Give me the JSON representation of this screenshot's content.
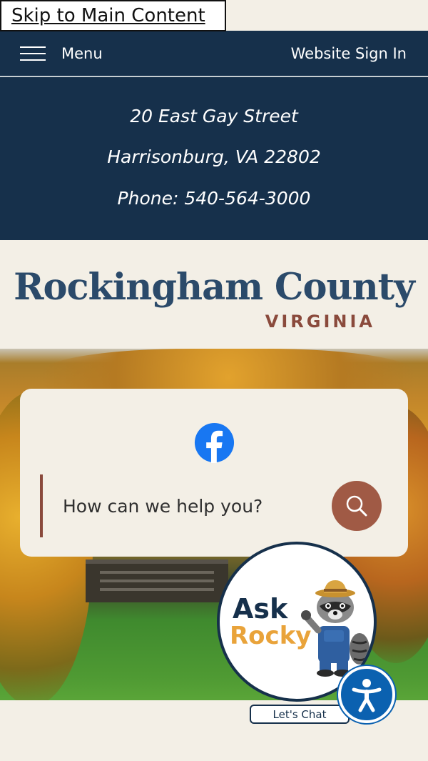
{
  "skip_link": "Skip to Main Content",
  "topbar": {
    "menu_label": "Menu",
    "signin_label": "Website Sign In"
  },
  "contact": {
    "address_line1": "20 East Gay Street",
    "address_line2": "Harrisonburg, VA 22802",
    "phone": "Phone: 540-564-3000"
  },
  "logo": {
    "title": "Rockingham County",
    "subtitle": "VIRGINIA"
  },
  "search": {
    "placeholder": "How can we help you?",
    "icon": "search-icon"
  },
  "social": {
    "icon": "facebook-icon",
    "color": "#1877f2"
  },
  "chat": {
    "ask": "Ask",
    "rocky": "Rocky",
    "button_label": "Let's Chat"
  },
  "colors": {
    "navy": "#16304b",
    "accent_brown": "#8a4a3c",
    "background": "#f3efe6",
    "accessibility_blue": "#0b61b0"
  }
}
